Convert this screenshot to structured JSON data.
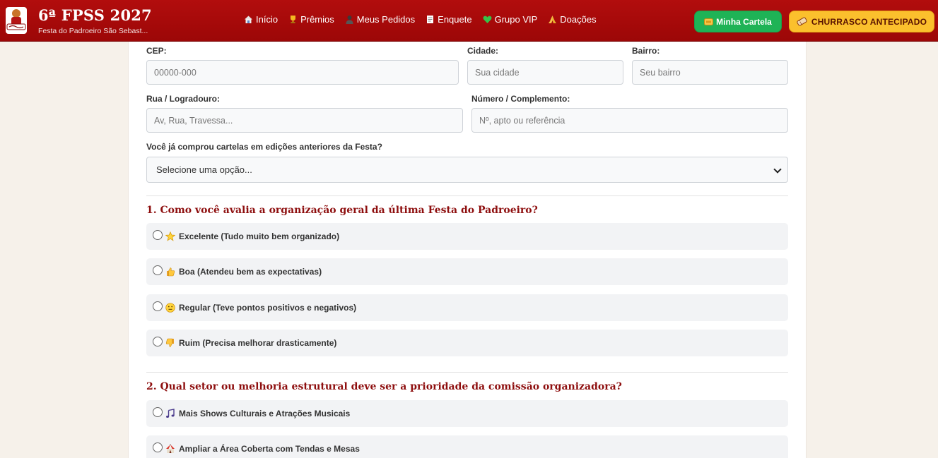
{
  "header": {
    "title": "6ª FPSS 2027",
    "subtitle": "Festa do Padroeiro São Sebast...",
    "nav": [
      {
        "label": "Início",
        "icon": "house-icon"
      },
      {
        "label": "Prêmios",
        "icon": "trophy-icon"
      },
      {
        "label": "Meus Pedidos",
        "icon": "person-icon"
      },
      {
        "label": "Enquete",
        "icon": "document-icon"
      },
      {
        "label": "Grupo VIP",
        "icon": "heart-icon"
      },
      {
        "label": "Doações",
        "icon": "praying-hands-icon"
      }
    ],
    "cartela_label": "Minha Cartela",
    "churrasco_label": "CHURRASCO ANTECIPADO"
  },
  "form": {
    "cep": {
      "label": "CEP:",
      "placeholder": "00000-000"
    },
    "cidade": {
      "label": "Cidade:",
      "placeholder": "Sua cidade"
    },
    "bairro": {
      "label": "Bairro:",
      "placeholder": "Seu bairro"
    },
    "rua": {
      "label": "Rua / Logradouro:",
      "placeholder": "Av, Rua, Travessa..."
    },
    "numero": {
      "label": "Número / Complemento:",
      "placeholder": "Nº, apto ou referência"
    },
    "anteriores": {
      "label": "Você já comprou cartelas em edições anteriores da Festa?",
      "selected": "Selecione uma opção..."
    }
  },
  "q1": {
    "title": "1. Como você avalia a organização geral da última Festa do Padroeiro?",
    "options": [
      {
        "label": "Excelente (Tudo muito bem organizado)",
        "icon": "star-icon"
      },
      {
        "label": "Boa (Atendeu bem as expectativas)",
        "icon": "thumbs-up-icon"
      },
      {
        "label": "Regular (Teve pontos positivos e negativos)",
        "icon": "neutral-face-icon"
      },
      {
        "label": "Ruim (Precisa melhorar drasticamente)",
        "icon": "thumbs-down-icon"
      }
    ]
  },
  "q2": {
    "title": "2. Qual setor ou melhoria estrutural deve ser a prioridade da comissão organizadora?",
    "options": [
      {
        "label": "Mais Shows Culturais e Atrações Musicais",
        "icon": "music-note-icon"
      },
      {
        "label": "Ampliar a Área Coberta com Tendas e Mesas",
        "icon": "circus-tent-icon"
      }
    ]
  }
}
